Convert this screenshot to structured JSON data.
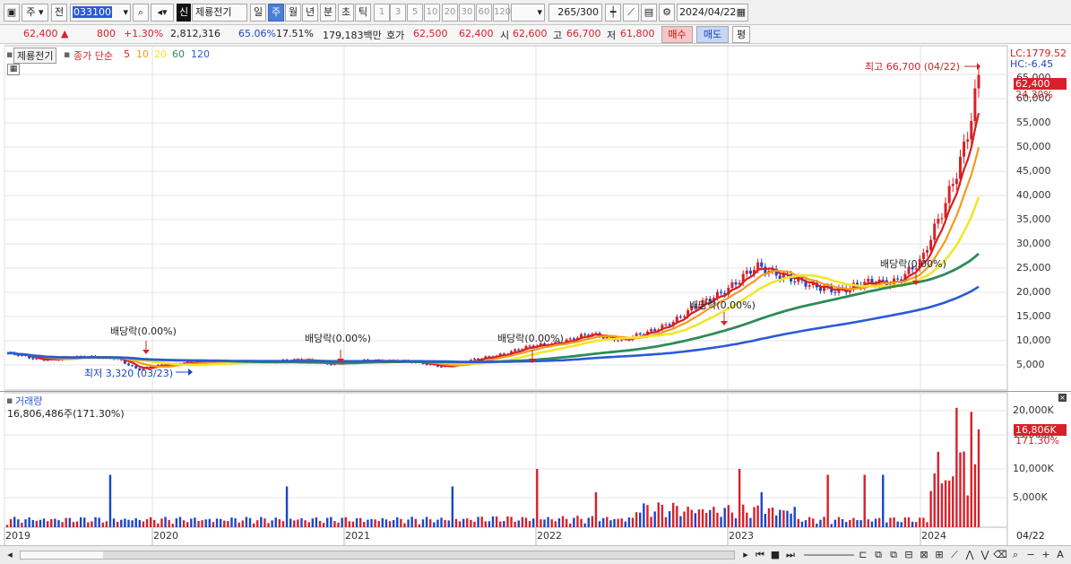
{
  "toolbar": {
    "market_label": "주",
    "prev_label": "전",
    "code": "033100",
    "new_badge": "신",
    "stock_name": "제룡전기",
    "periods": [
      "일",
      "주",
      "월",
      "년",
      "분",
      "초",
      "틱"
    ],
    "active_period": "주",
    "intervals": [
      "1",
      "3",
      "5",
      "10",
      "20",
      "30",
      "60",
      "120"
    ],
    "count": "265",
    "count_total": "/300",
    "date": "2024/04/22"
  },
  "quote": {
    "price": "62,400",
    "change_arrow": "▲",
    "change": "800",
    "change_pct": "+1.30%",
    "volume": "2,812,316",
    "vol_ratio": "65.06%",
    "turnover": "17.51%",
    "amount": "179,183백만",
    "bid_label": "호가",
    "bid": "62,500",
    "ask": "62,400",
    "open_label": "시",
    "open": "62,600",
    "high_label": "고",
    "high": "66,700",
    "low_label": "저",
    "low": "61,800",
    "buy_label": "매수",
    "sell_label": "매도",
    "avg_label": "평"
  },
  "legend": {
    "title_box": "제룡전기",
    "ma_label": "종가 단순",
    "ma_periods": [
      "5",
      "10",
      "20",
      "60",
      "120"
    ],
    "ma_colors": [
      "#d81e1e",
      "#f39a1e",
      "#f2e628",
      "#2e8b57",
      "#2a5ad8"
    ]
  },
  "price_axis": {
    "lc": "LC:1779.52",
    "hc": "HC:-6.45",
    "ticks": [
      "65,000",
      "60,000",
      "55,000",
      "50,000",
      "45,000",
      "40,000",
      "35,000",
      "30,000",
      "25,000",
      "20,000",
      "15,000",
      "10,000",
      "5,000"
    ],
    "last_price": "62,400",
    "last_pct": "24.30%"
  },
  "annotations": {
    "high": "최고 66,700 (04/22)",
    "low": "최저 3,320 (03/23)",
    "dividend": "배당락(0.00%)"
  },
  "volume": {
    "title": "거래량",
    "value": "16,806,486주(171.30%)",
    "ticks": [
      "20,000K",
      "15,000K",
      "10,000K",
      "5,000K"
    ],
    "last_value": "16,806K",
    "last_pct": "171.30%"
  },
  "xaxis": {
    "years": [
      "2019",
      "2020",
      "2021",
      "2022",
      "2023",
      "2024"
    ],
    "last_date": "04/22"
  },
  "chart_data": {
    "type": "candlestick",
    "title": "제룡전기 주봉",
    "x_range": [
      "2019",
      "2024/04/22"
    ],
    "ylim": [
      0,
      67000
    ],
    "moving_averages": [
      "5",
      "10",
      "20",
      "60",
      "120"
    ],
    "close_by_year_approx": [
      {
        "x": "2019",
        "close": 7200
      },
      {
        "x": "2020",
        "close": 5500
      },
      {
        "x": "2021",
        "close": 5500
      },
      {
        "x": "2022",
        "close": 5000
      },
      {
        "x": "2023",
        "close": 10000
      },
      {
        "x": "2024",
        "close": 21000
      },
      {
        "x": "2024/04/22",
        "close": 62400
      }
    ],
    "last_close": 62400,
    "period_high": 66700,
    "period_low": 3320,
    "last_volume": 16806486
  }
}
